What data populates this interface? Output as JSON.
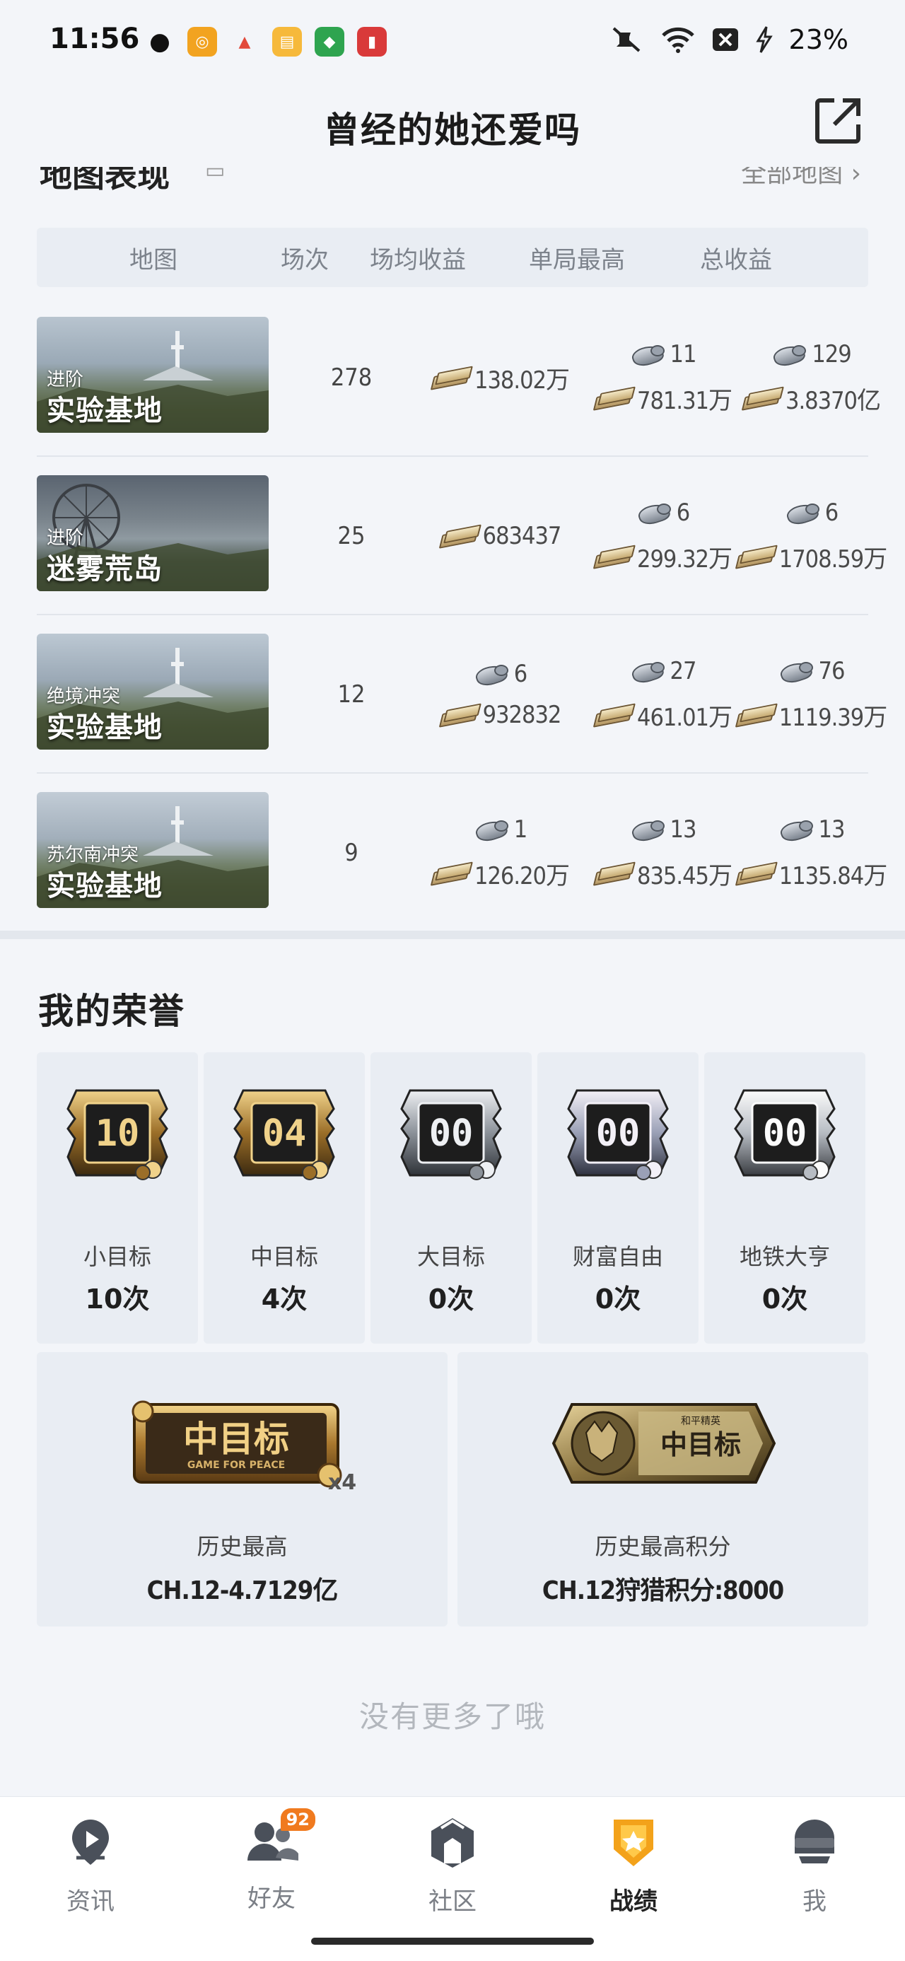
{
  "status_bar": {
    "time": "11:56",
    "battery": "23%",
    "icons": [
      "wechat-icon",
      "app-icon-1",
      "app-icon-2",
      "app-icon-3",
      "app-icon-4",
      "app-icon-5",
      "mute-icon",
      "wifi-icon",
      "battery-x-icon",
      "charging-icon"
    ]
  },
  "header": {
    "title": "曾经的她还爱吗",
    "share_icon": "share-icon"
  },
  "map_section": {
    "title": "地图表现",
    "link": "全部地图",
    "columns": [
      "地图",
      "场次",
      "场均收益",
      "单局最高",
      "总收益"
    ],
    "rows": [
      {
        "mode": "进阶",
        "map": "实验基地",
        "matches": "278",
        "avg": {
          "bag": "",
          "cash": "138.02万"
        },
        "max": {
          "bag": "11",
          "cash": "781.31万"
        },
        "total": {
          "bag": "129",
          "cash": "3.8370亿"
        }
      },
      {
        "mode": "进阶",
        "map": "迷雾荒岛",
        "matches": "25",
        "avg": {
          "bag": "",
          "cash": "683437"
        },
        "max": {
          "bag": "6",
          "cash": "299.32万"
        },
        "total": {
          "bag": "6",
          "cash": "1708.59万"
        }
      },
      {
        "mode": "绝境冲突",
        "map": "实验基地",
        "matches": "12",
        "avg": {
          "bag": "6",
          "cash": "932832"
        },
        "max": {
          "bag": "27",
          "cash": "461.01万"
        },
        "total": {
          "bag": "76",
          "cash": "1119.39万"
        }
      },
      {
        "mode": "苏尔南冲突",
        "map": "实验基地",
        "matches": "9",
        "avg": {
          "bag": "1",
          "cash": "126.20万"
        },
        "max": {
          "bag": "13",
          "cash": "835.45万"
        },
        "total": {
          "bag": "13",
          "cash": "1135.84万"
        }
      }
    ]
  },
  "honor": {
    "title": "我的荣誉",
    "badges": [
      {
        "number": "10",
        "label": "小目标",
        "count": "10次",
        "tone": "gold"
      },
      {
        "number": "04",
        "label": "中目标",
        "count": "4次",
        "tone": "gold"
      },
      {
        "number": "00",
        "label": "大目标",
        "count": "0次",
        "tone": "silver"
      },
      {
        "number": "00",
        "label": "财富自由",
        "count": "0次",
        "tone": "holo"
      },
      {
        "number": "00",
        "label": "地铁大亨",
        "count": "0次",
        "tone": "platinum"
      }
    ],
    "records": [
      {
        "art_text": "中目标",
        "art_sub": "GAME FOR PEACE",
        "art_mult": "x4",
        "label": "历史最高",
        "value": "CH.12-4.7129亿"
      },
      {
        "art_text": "中目标",
        "art_sub": "和平精英",
        "art_mult": "",
        "label": "历史最高积分",
        "value": "CH.12狩猎积分:8000"
      }
    ]
  },
  "footer_note": "没有更多了哦",
  "tabbar": {
    "tabs": [
      {
        "label": "资讯",
        "icon": "news-icon",
        "active": false
      },
      {
        "label": "好友",
        "icon": "friends-icon",
        "badge": "92",
        "active": false
      },
      {
        "label": "社区",
        "icon": "community-icon",
        "active": false
      },
      {
        "label": "战绩",
        "icon": "record-icon",
        "active": true
      },
      {
        "label": "我",
        "icon": "me-icon",
        "active": false
      }
    ]
  }
}
